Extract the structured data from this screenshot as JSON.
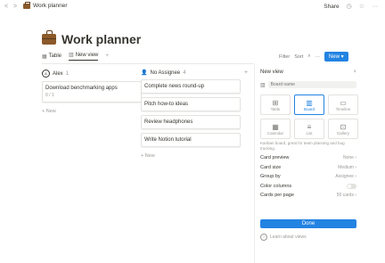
{
  "topbar": {
    "nav": "< > +",
    "breadcrumb": "Work planner",
    "share": "Share",
    "clock_icon": "clock-icon",
    "star_icon": "star-icon",
    "more": "···"
  },
  "page": {
    "icon": "briefcase-icon",
    "title": "Work planner"
  },
  "tabs": [
    {
      "label": "Table",
      "icon": "table-icon"
    },
    {
      "label": "New view",
      "icon": "board-icon",
      "active": true
    }
  ],
  "tabs_add": "+",
  "toolbar": {
    "filter": "Filter",
    "sort": "Sort",
    "search_icon": "search-icon",
    "more": "···",
    "new": "New",
    "new_caret": "▾"
  },
  "columns": [
    {
      "header": "Alex",
      "count": "1",
      "cards": [
        {
          "title": "Download benchmarking apps",
          "sub": "0 / 1"
        }
      ],
      "add": "+ New"
    },
    {
      "header": "No Assignee",
      "count": "4",
      "cards": [
        {
          "title": "Complete news round-up"
        },
        {
          "title": "Pitch how-to ideas"
        },
        {
          "title": "Review headphones"
        },
        {
          "title": "Write Notion tutorial"
        }
      ],
      "add": "+ New"
    }
  ],
  "panel": {
    "title": "New view",
    "close": "×",
    "name_placeholder": "Board name",
    "layouts": [
      {
        "label": "Table",
        "icon": "⊞"
      },
      {
        "label": "Board",
        "icon": "▥",
        "selected": true
      },
      {
        "label": "Timeline",
        "icon": "▭"
      },
      {
        "label": "Calendar",
        "icon": "▦"
      },
      {
        "label": "List",
        "icon": "≡"
      },
      {
        "label": "Gallery",
        "icon": "⊡"
      }
    ],
    "description": "Kanban board, great for team planning and bug tracking.",
    "rows": [
      {
        "label": "Card preview",
        "value": "None ›"
      },
      {
        "label": "Card size",
        "value": "Medium ›"
      },
      {
        "label": "Group by",
        "value": "Assignee ›"
      },
      {
        "label": "Color columns",
        "toggle": true
      },
      {
        "label": "Cards per page",
        "value": "50 cards ›"
      }
    ],
    "done": "Done",
    "learn": "Learn about views"
  },
  "colors": {
    "accent": "#2383e2",
    "text": "#37352f",
    "muted": "#9b9a97"
  }
}
